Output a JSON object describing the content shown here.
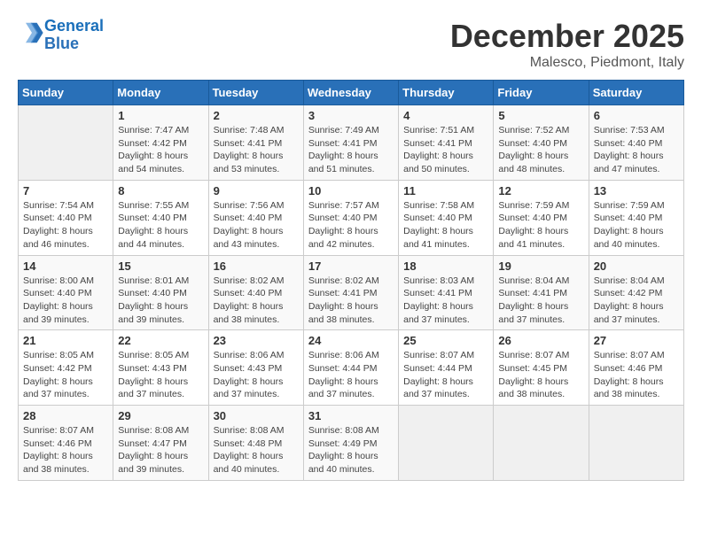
{
  "header": {
    "logo_line1": "General",
    "logo_line2": "Blue",
    "month": "December 2025",
    "location": "Malesco, Piedmont, Italy"
  },
  "weekdays": [
    "Sunday",
    "Monday",
    "Tuesday",
    "Wednesday",
    "Thursday",
    "Friday",
    "Saturday"
  ],
  "weeks": [
    [
      {
        "day": "",
        "info": ""
      },
      {
        "day": "1",
        "info": "Sunrise: 7:47 AM\nSunset: 4:42 PM\nDaylight: 8 hours\nand 54 minutes."
      },
      {
        "day": "2",
        "info": "Sunrise: 7:48 AM\nSunset: 4:41 PM\nDaylight: 8 hours\nand 53 minutes."
      },
      {
        "day": "3",
        "info": "Sunrise: 7:49 AM\nSunset: 4:41 PM\nDaylight: 8 hours\nand 51 minutes."
      },
      {
        "day": "4",
        "info": "Sunrise: 7:51 AM\nSunset: 4:41 PM\nDaylight: 8 hours\nand 50 minutes."
      },
      {
        "day": "5",
        "info": "Sunrise: 7:52 AM\nSunset: 4:40 PM\nDaylight: 8 hours\nand 48 minutes."
      },
      {
        "day": "6",
        "info": "Sunrise: 7:53 AM\nSunset: 4:40 PM\nDaylight: 8 hours\nand 47 minutes."
      }
    ],
    [
      {
        "day": "7",
        "info": "Sunrise: 7:54 AM\nSunset: 4:40 PM\nDaylight: 8 hours\nand 46 minutes."
      },
      {
        "day": "8",
        "info": "Sunrise: 7:55 AM\nSunset: 4:40 PM\nDaylight: 8 hours\nand 44 minutes."
      },
      {
        "day": "9",
        "info": "Sunrise: 7:56 AM\nSunset: 4:40 PM\nDaylight: 8 hours\nand 43 minutes."
      },
      {
        "day": "10",
        "info": "Sunrise: 7:57 AM\nSunset: 4:40 PM\nDaylight: 8 hours\nand 42 minutes."
      },
      {
        "day": "11",
        "info": "Sunrise: 7:58 AM\nSunset: 4:40 PM\nDaylight: 8 hours\nand 41 minutes."
      },
      {
        "day": "12",
        "info": "Sunrise: 7:59 AM\nSunset: 4:40 PM\nDaylight: 8 hours\nand 41 minutes."
      },
      {
        "day": "13",
        "info": "Sunrise: 7:59 AM\nSunset: 4:40 PM\nDaylight: 8 hours\nand 40 minutes."
      }
    ],
    [
      {
        "day": "14",
        "info": "Sunrise: 8:00 AM\nSunset: 4:40 PM\nDaylight: 8 hours\nand 39 minutes."
      },
      {
        "day": "15",
        "info": "Sunrise: 8:01 AM\nSunset: 4:40 PM\nDaylight: 8 hours\nand 39 minutes."
      },
      {
        "day": "16",
        "info": "Sunrise: 8:02 AM\nSunset: 4:40 PM\nDaylight: 8 hours\nand 38 minutes."
      },
      {
        "day": "17",
        "info": "Sunrise: 8:02 AM\nSunset: 4:41 PM\nDaylight: 8 hours\nand 38 minutes."
      },
      {
        "day": "18",
        "info": "Sunrise: 8:03 AM\nSunset: 4:41 PM\nDaylight: 8 hours\nand 37 minutes."
      },
      {
        "day": "19",
        "info": "Sunrise: 8:04 AM\nSunset: 4:41 PM\nDaylight: 8 hours\nand 37 minutes."
      },
      {
        "day": "20",
        "info": "Sunrise: 8:04 AM\nSunset: 4:42 PM\nDaylight: 8 hours\nand 37 minutes."
      }
    ],
    [
      {
        "day": "21",
        "info": "Sunrise: 8:05 AM\nSunset: 4:42 PM\nDaylight: 8 hours\nand 37 minutes."
      },
      {
        "day": "22",
        "info": "Sunrise: 8:05 AM\nSunset: 4:43 PM\nDaylight: 8 hours\nand 37 minutes."
      },
      {
        "day": "23",
        "info": "Sunrise: 8:06 AM\nSunset: 4:43 PM\nDaylight: 8 hours\nand 37 minutes."
      },
      {
        "day": "24",
        "info": "Sunrise: 8:06 AM\nSunset: 4:44 PM\nDaylight: 8 hours\nand 37 minutes."
      },
      {
        "day": "25",
        "info": "Sunrise: 8:07 AM\nSunset: 4:44 PM\nDaylight: 8 hours\nand 37 minutes."
      },
      {
        "day": "26",
        "info": "Sunrise: 8:07 AM\nSunset: 4:45 PM\nDaylight: 8 hours\nand 38 minutes."
      },
      {
        "day": "27",
        "info": "Sunrise: 8:07 AM\nSunset: 4:46 PM\nDaylight: 8 hours\nand 38 minutes."
      }
    ],
    [
      {
        "day": "28",
        "info": "Sunrise: 8:07 AM\nSunset: 4:46 PM\nDaylight: 8 hours\nand 38 minutes."
      },
      {
        "day": "29",
        "info": "Sunrise: 8:08 AM\nSunset: 4:47 PM\nDaylight: 8 hours\nand 39 minutes."
      },
      {
        "day": "30",
        "info": "Sunrise: 8:08 AM\nSunset: 4:48 PM\nDaylight: 8 hours\nand 40 minutes."
      },
      {
        "day": "31",
        "info": "Sunrise: 8:08 AM\nSunset: 4:49 PM\nDaylight: 8 hours\nand 40 minutes."
      },
      {
        "day": "",
        "info": ""
      },
      {
        "day": "",
        "info": ""
      },
      {
        "day": "",
        "info": ""
      }
    ]
  ]
}
